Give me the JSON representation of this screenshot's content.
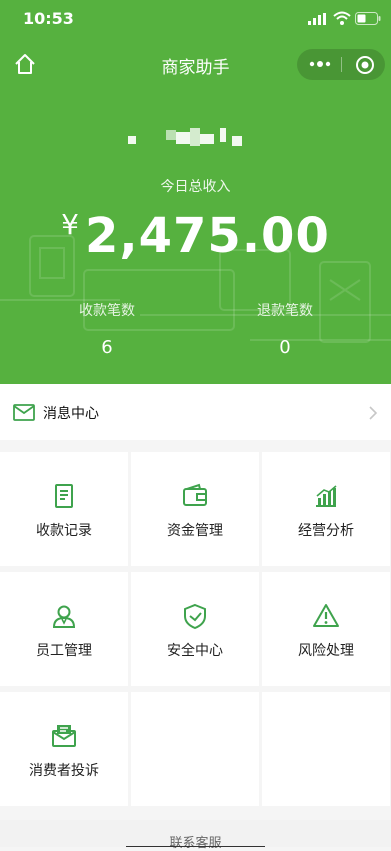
{
  "status": {
    "time": "10:53"
  },
  "nav": {
    "title": "商家助手"
  },
  "summary": {
    "caption": "今日总收入",
    "currency": "¥",
    "amount": "2,475.00",
    "received_label": "收款笔数",
    "received_count": "6",
    "refund_label": "退款笔数",
    "refund_count": "0"
  },
  "message_center": {
    "label": "消息中心"
  },
  "menu": [
    {
      "label": "收款记录",
      "icon": "receipt-icon"
    },
    {
      "label": "资金管理",
      "icon": "wallet-icon"
    },
    {
      "label": "经营分析",
      "icon": "bar-chart-icon"
    },
    {
      "label": "员工管理",
      "icon": "user-icon"
    },
    {
      "label": "安全中心",
      "icon": "shield-icon"
    },
    {
      "label": "风险处理",
      "icon": "warning-icon"
    },
    {
      "label": "消费者投诉",
      "icon": "complaint-mail-icon"
    }
  ],
  "footer": {
    "link": "联系客服"
  },
  "colors": {
    "brand_green": "#56b13f",
    "icon_green": "#3fa34d"
  }
}
